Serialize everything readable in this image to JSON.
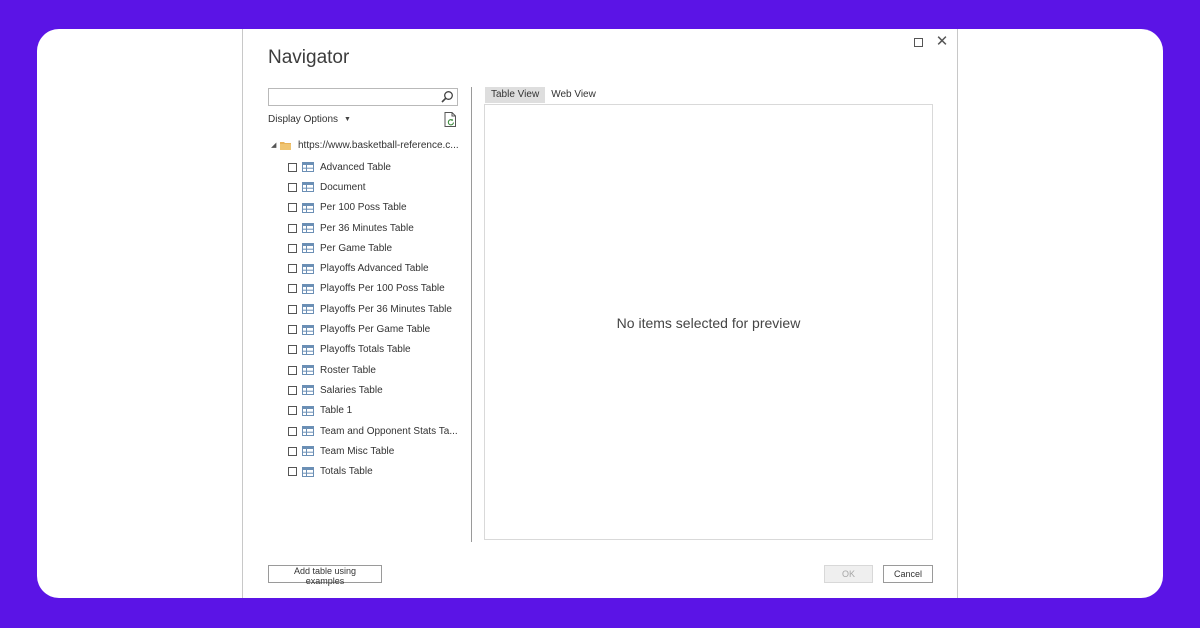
{
  "window": {
    "title": "Navigator",
    "maximize_label": "",
    "close_label": "✕"
  },
  "search": {
    "value": "",
    "placeholder": ""
  },
  "display_options": {
    "label": "Display Options",
    "caret": "▼"
  },
  "tree": {
    "expander": "◢",
    "root_label": "https://www.basketball-reference.c...",
    "items": [
      "Advanced Table",
      "Document",
      "Per 100 Poss Table",
      "Per 36 Minutes Table",
      "Per Game Table",
      "Playoffs Advanced Table",
      "Playoffs Per 100 Poss Table",
      "Playoffs Per 36 Minutes Table",
      "Playoffs Per Game Table",
      "Playoffs Totals Table",
      "Roster Table",
      "Salaries Table",
      "Table 1",
      "Team and Opponent Stats Ta...",
      "Team Misc Table",
      "Totals Table"
    ]
  },
  "tabs": [
    {
      "label": "Table View",
      "active": true
    },
    {
      "label": "Web View",
      "active": false
    }
  ],
  "preview": {
    "message": "No items selected for preview"
  },
  "footer": {
    "add_table_label": "Add table using examples",
    "ok_label": "OK",
    "cancel_label": "Cancel"
  },
  "colors": {
    "frame_background": "#5b14e6",
    "folder": "#e8b35a",
    "table_icon": "#6b8fb5"
  }
}
